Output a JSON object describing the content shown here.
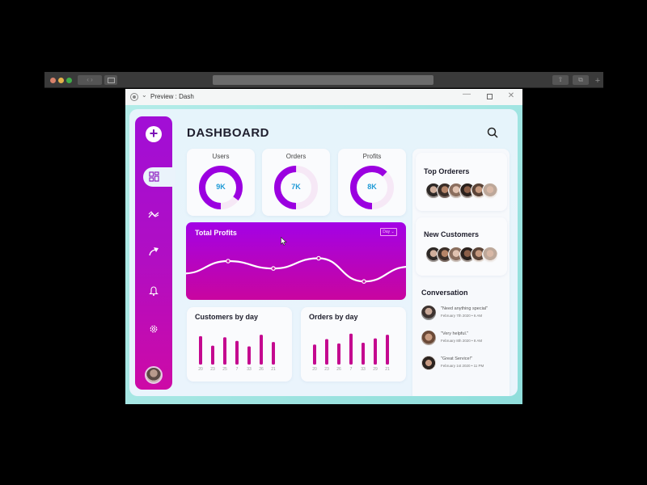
{
  "window": {
    "title": "Preview : Dash",
    "minimize_label": "—",
    "close_label": "✕"
  },
  "browser": {
    "nav_label": "‹ ›",
    "share_label": "⇧",
    "tabs_label": "⧉",
    "newtab_label": "+"
  },
  "sidebar": {
    "add_label": "+",
    "items": [
      {
        "name": "dashboard",
        "icon": "dashboard-grid-icon",
        "active": true
      },
      {
        "name": "analytics",
        "icon": "trend-icon",
        "glyph": "⤳"
      },
      {
        "name": "send",
        "icon": "send-arrow-icon",
        "glyph": "➚"
      },
      {
        "name": "notifications",
        "icon": "bell-icon",
        "glyph": "🔔"
      },
      {
        "name": "settings",
        "icon": "gear-icon",
        "glyph": "⚙"
      }
    ]
  },
  "header": {
    "title": "DASHBOARD"
  },
  "stats": [
    {
      "label": "Users",
      "value": "9K",
      "fraction": 0.85
    },
    {
      "label": "Orders",
      "value": "7K",
      "fraction": 0.5
    },
    {
      "label": "Profits",
      "value": "8K",
      "fraction": 0.62
    }
  ],
  "colors": {
    "accent_purple": "#9b00e0",
    "accent_magenta": "#c9059f",
    "value_blue": "#1e9ad6",
    "ring_track": "#f6e8f6"
  },
  "total_profits": {
    "title": "Total Profits",
    "period": "Day ⌄",
    "chart_data": {
      "type": "line",
      "title": "Total Profits",
      "x": [
        0,
        1,
        2,
        3,
        4,
        5
      ],
      "values": [
        38,
        60,
        47,
        65,
        24,
        50
      ],
      "marked_points": [
        1,
        2,
        3,
        4
      ],
      "ylim": [
        0,
        100
      ],
      "grid": false
    }
  },
  "customers_by_day": {
    "title": "Customers by day",
    "chart_data": {
      "type": "bar",
      "title": "Customers by day",
      "categories": [
        "20",
        "23",
        "25",
        "7",
        "33",
        "26",
        "21"
      ],
      "values": [
        78,
        52,
        75,
        65,
        50,
        82,
        62
      ],
      "ylim": [
        0,
        100
      ]
    }
  },
  "orders_by_day": {
    "title": "Orders by day",
    "chart_data": {
      "type": "bar",
      "title": "Orders by day",
      "categories": [
        "20",
        "23",
        "26",
        "7",
        "33",
        "29",
        "21"
      ],
      "values": [
        55,
        70,
        58,
        85,
        60,
        72,
        82
      ],
      "ylim": [
        0,
        100
      ]
    }
  },
  "top_orderers": {
    "title": "Top Orderers",
    "avatar_count": 6
  },
  "new_customers": {
    "title": "New Customers",
    "avatar_count": 6
  },
  "conversation": {
    "title": "Conversation",
    "items": [
      {
        "message": "\"Need anything special\"",
        "time": "February 7th 2020 • 6 AM"
      },
      {
        "message": "\"Very helpful.\"",
        "time": "February 8th 2020 • 8 AM"
      },
      {
        "message": "\"Great Service!\"",
        "time": "February 1st 2020 • 11 PM"
      }
    ]
  }
}
